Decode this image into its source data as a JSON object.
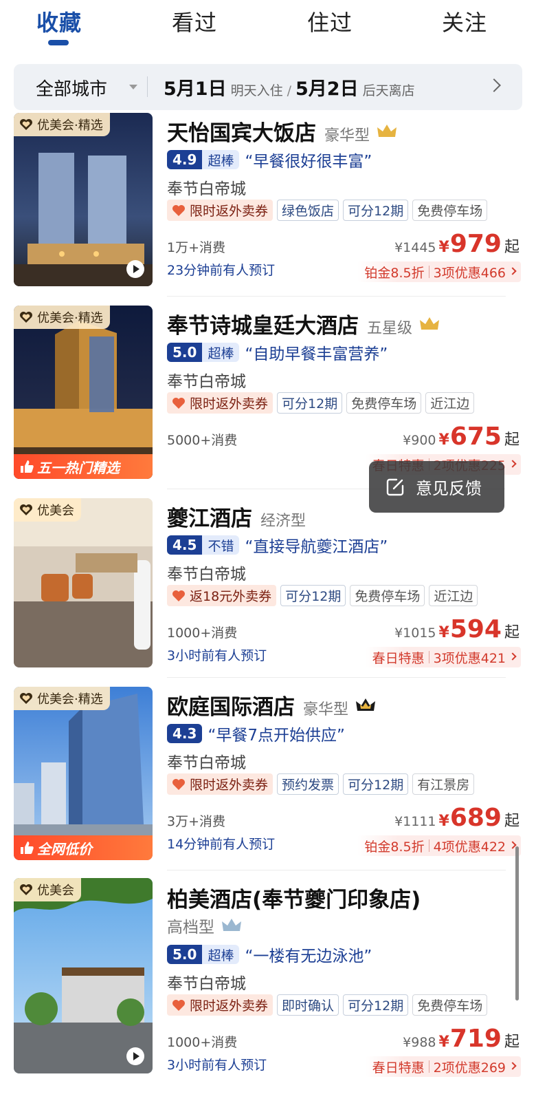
{
  "tabs": [
    {
      "label": "收藏",
      "active": true
    },
    {
      "label": "看过",
      "active": false
    },
    {
      "label": "住过",
      "active": false
    },
    {
      "label": "关注",
      "active": false
    }
  ],
  "filter": {
    "city": "全部城市",
    "checkin_date": "5月1日",
    "checkin_note": "明天入住",
    "separator": "/",
    "checkout_date": "5月2日",
    "checkout_note": "后天离店"
  },
  "hotels": [
    {
      "badge": "优美会·精选",
      "name": "天怡国宾大饭店",
      "class": "豪华型",
      "crown_color": "#e6b340",
      "score": "4.9",
      "score_label": "超棒",
      "quote": "“早餐很好很丰富”",
      "location": "奉节白帝城",
      "tags": [
        "限时返外卖券",
        "绿色饭店",
        "可分12期",
        "免费停车场"
      ],
      "consumption": "1万+消费",
      "booked": "23分钟前有人预订",
      "old_price": "¥1445",
      "currency": "¥",
      "price": "979",
      "price_suffix": "起",
      "deals": [
        "铂金8.5折",
        "3项优惠466"
      ]
    },
    {
      "badge": "优美会·精选",
      "name": "奉节诗城皇廷大酒店",
      "class": "五星级",
      "crown_color": "#e6b340",
      "score": "5.0",
      "score_label": "超棒",
      "quote": "“自助早餐丰富营养”",
      "location": "奉节白帝城",
      "tags": [
        "限时返外卖券",
        "可分12期",
        "免费停车场",
        "近江边"
      ],
      "consumption": "5000+消费",
      "booked": "",
      "old_price": "¥900",
      "currency": "¥",
      "price": "675",
      "price_suffix": "起",
      "deals": [
        "春日特惠",
        "2项优惠225"
      ],
      "photo_banner": "五一热门精选"
    },
    {
      "badge": "优美会",
      "name": "夔江酒店",
      "class": "经济型",
      "score": "4.5",
      "score_label": "不错",
      "quote": "“直接导航夔江酒店”",
      "location": "奉节白帝城",
      "tags": [
        "返18元外卖券",
        "可分12期",
        "免费停车场",
        "近江边"
      ],
      "consumption": "1000+消费",
      "booked": "3小时前有人预订",
      "old_price": "¥1015",
      "currency": "¥",
      "price": "594",
      "price_suffix": "起",
      "deals": [
        "春日特惠",
        "3项优惠421"
      ]
    },
    {
      "badge": "优美会·精选",
      "name": "欧庭国际酒店",
      "class": "豪华型",
      "crown_color": "#1a1a1a",
      "score": "4.3",
      "score_label": "",
      "quote": "“早餐7点开始供应”",
      "location": "奉节白帝城",
      "tags": [
        "限时返外卖券",
        "预约发票",
        "可分12期",
        "有江景房"
      ],
      "consumption": "3万+消费",
      "booked": "14分钟前有人预订",
      "old_price": "¥1111",
      "currency": "¥",
      "price": "689",
      "price_suffix": "起",
      "deals": [
        "铂金8.5折",
        "4项优惠422"
      ],
      "photo_banner": "全网低价"
    },
    {
      "badge": "优美会",
      "name": "柏美酒店(奉节夔门印象店)",
      "class": "高档型",
      "crown_color": "#9ab7d0",
      "score": "5.0",
      "score_label": "超棒",
      "quote": "“一楼有无边泳池”",
      "location": "奉节白帝城",
      "tags": [
        "限时返外卖券",
        "即时确认",
        "可分12期",
        "免费停车场"
      ],
      "consumption": "1000+消费",
      "booked": "3小时前有人预订",
      "old_price": "¥988",
      "currency": "¥",
      "price": "719",
      "price_suffix": "起",
      "deals": [
        "春日特惠",
        "2项优惠269"
      ]
    }
  ],
  "feedback": {
    "label": "意见反馈",
    "icon": "edit-note-icon"
  },
  "colors": {
    "brand_blue": "#1c3f94",
    "price_red": "#d8352a",
    "promo_bg": "#fde8e0"
  }
}
